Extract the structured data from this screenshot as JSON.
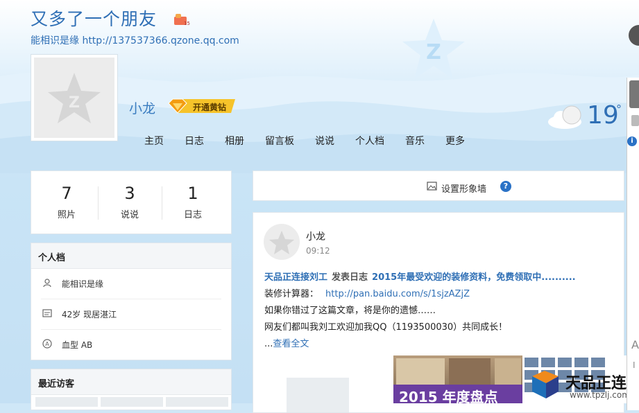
{
  "header": {
    "title": "又多了一个朋友",
    "subtitle": "能相识是缘 http://137537366.qzone.qq.com"
  },
  "profile_header": {
    "username": "小龙",
    "vip_label": "开通黄钻"
  },
  "nav": {
    "items": [
      "主页",
      "日志",
      "相册",
      "留言板",
      "说说",
      "个人档",
      "音乐",
      "更多"
    ]
  },
  "weather": {
    "temperature": "19",
    "degree": "°"
  },
  "stats": [
    {
      "value": "7",
      "label": "照片"
    },
    {
      "value": "3",
      "label": "说说"
    },
    {
      "value": "1",
      "label": "日志"
    }
  ],
  "profile_card": {
    "title": "个人档",
    "rows": [
      {
        "icon": "person-icon",
        "text": "能相识是缘"
      },
      {
        "icon": "card-icon",
        "text": "42岁  现居湛江"
      },
      {
        "icon": "bloodtype-icon",
        "text": "血型 AB"
      }
    ]
  },
  "visitors": {
    "title": "最近访客"
  },
  "banner": {
    "label": "设置形象墙",
    "help": "?"
  },
  "post": {
    "author": "小龙",
    "time": "09:12",
    "source": "天品正连接刘工",
    "action": "发表日志",
    "headline": "2015年最受欢迎的装修资料，免费领取中..........",
    "line2_prefix": "装修计算器：",
    "line2_link": "http://pan.baidu.com/s/1sjzAZjZ",
    "line3": "如果你错过了这篇文章，将是你的遗憾……",
    "line4": "网友们都叫我刘工欢迎加我QQ（1193500030）共同成长！",
    "more_prefix": "...",
    "more_link": "查看全文"
  },
  "ad": {
    "year_text": "2015 年度盘点",
    "brand": "天品正连接",
    "url": "www.tpzlj.com"
  },
  "colors": {
    "accent": "#2f6fb5",
    "vip_gold": "#f6c32a",
    "info_blue": "#2a72c6"
  }
}
